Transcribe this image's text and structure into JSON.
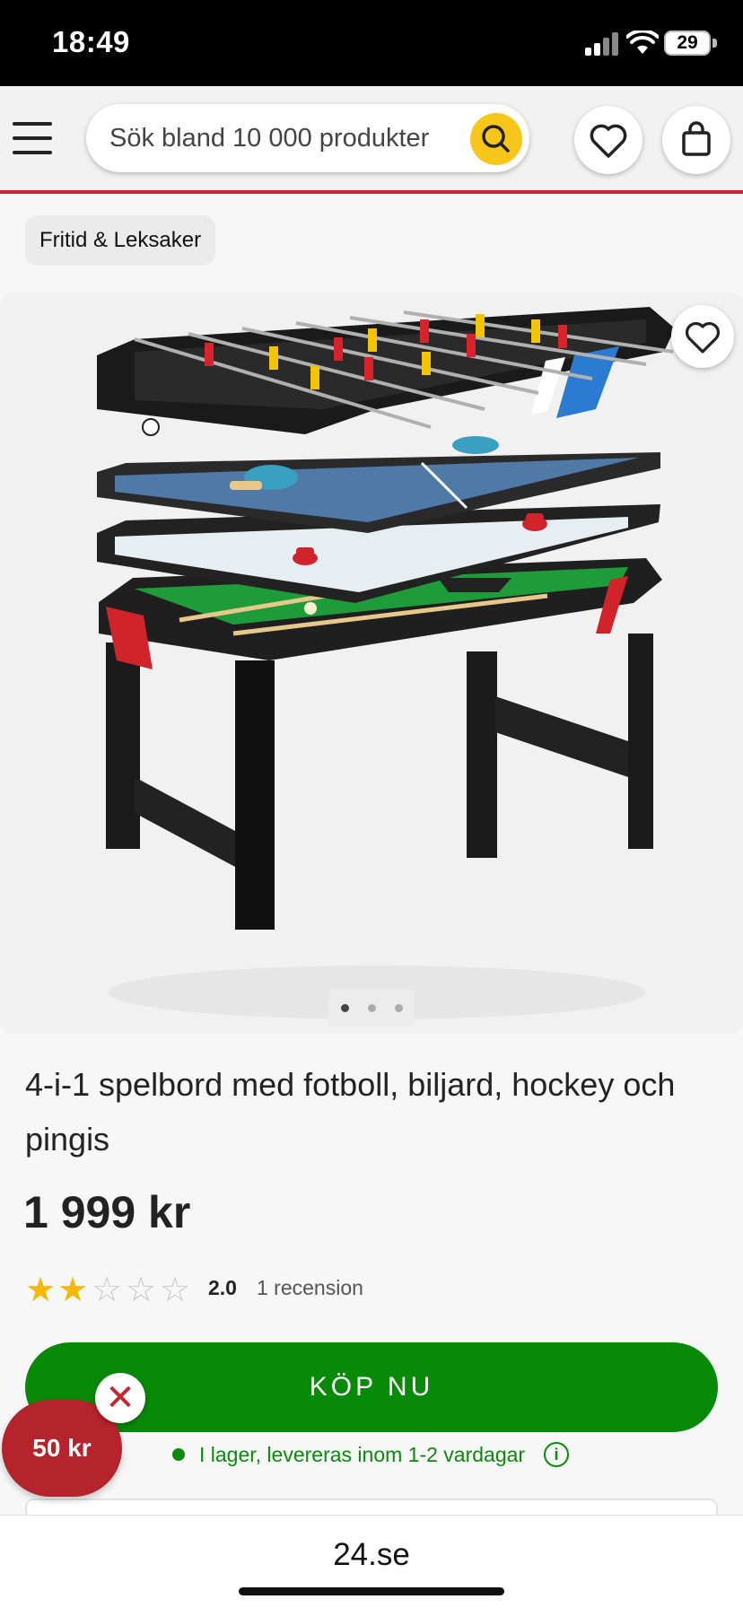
{
  "status_bar": {
    "time": "18:49",
    "battery": "29"
  },
  "header": {
    "search_placeholder": "Sök bland 10 000 produkter",
    "icons": [
      "menu-icon",
      "search-icon",
      "heart-icon",
      "shopping-bag-icon"
    ]
  },
  "breadcrumb": {
    "label": "Fritid & Leksaker"
  },
  "gallery": {
    "image_count": 3,
    "active_index": 0
  },
  "product": {
    "title": "4-i-1 spelbord med fotboll, biljard, hockey och pingis",
    "price": "1 999 kr",
    "rating_value": "2.0",
    "rating_stars": 2,
    "rating_max": 5,
    "review_count": "1 recension",
    "buy_label": "KÖP NU",
    "stock_text": "I lager, levereras inom 1-2 vardagar"
  },
  "coupon": {
    "label": "50 kr"
  },
  "browser": {
    "url": "24.se"
  },
  "colors": {
    "accent_red": "#c3262f",
    "buy_green": "#078a07",
    "search_yellow": "#f8c51b",
    "star_gold": "#f5b800"
  }
}
